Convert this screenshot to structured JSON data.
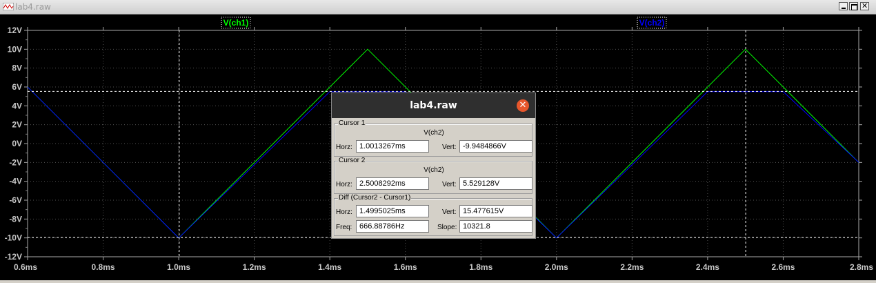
{
  "window": {
    "title": "lab4.raw"
  },
  "plot": {
    "trace_labels": [
      {
        "text": "V(ch1)",
        "color": "#00ff00"
      },
      {
        "text": "V(ch2)",
        "color": "#0000ff"
      }
    ],
    "y_ticks": [
      "12V",
      "10V",
      "8V",
      "6V",
      "4V",
      "2V",
      "0V",
      "-2V",
      "-4V",
      "-6V",
      "-8V",
      "-10V",
      "-12V"
    ],
    "x_ticks": [
      "0.6ms",
      "0.8ms",
      "1.0ms",
      "1.2ms",
      "1.4ms",
      "1.6ms",
      "1.8ms",
      "2.0ms",
      "2.2ms",
      "2.4ms",
      "2.6ms",
      "2.8ms"
    ]
  },
  "chart_data": {
    "type": "line",
    "xlabel": "",
    "ylabel": "",
    "xlim": [
      0.6,
      2.8
    ],
    "ylim": [
      -12,
      12
    ],
    "grid": true,
    "series": [
      {
        "name": "V(ch1)",
        "color": "#00ff00",
        "x": [
          0.6,
          1.0,
          1.5,
          2.0,
          2.5,
          2.8
        ],
        "y": [
          6,
          -10,
          10,
          -10,
          10,
          -2
        ]
      },
      {
        "name": "V(ch2)",
        "color": "#0000ff",
        "x": [
          0.6,
          1.0,
          1.4,
          1.6,
          2.0,
          2.4,
          2.6,
          2.8
        ],
        "y": [
          6,
          -10,
          5.5,
          5.5,
          -10,
          5.5,
          5.5,
          -2
        ]
      }
    ],
    "cursors": {
      "x": [
        1.0013267,
        2.5008292
      ],
      "y": [
        -9.9484866,
        5.529128
      ]
    }
  },
  "dialog": {
    "title": "lab4.raw",
    "cursor1": {
      "label": "Cursor 1",
      "trace": "V(ch2)",
      "horz_label": "Horz:",
      "horz": "1.0013267ms",
      "vert_label": "Vert:",
      "vert": "-9.9484866V"
    },
    "cursor2": {
      "label": "Cursor 2",
      "trace": "V(ch2)",
      "horz_label": "Horz:",
      "horz": "2.5008292ms",
      "vert_label": "Vert:",
      "vert": "5.529128V"
    },
    "diff": {
      "label": "Diff (Cursor2 - Cursor1)",
      "horz_label": "Horz:",
      "horz": "1.4995025ms",
      "vert_label": "Vert:",
      "vert": "15.477615V",
      "freq_label": "Freq:",
      "freq": "666.88786Hz",
      "slope_label": "Slope:",
      "slope": "10321.8"
    }
  }
}
